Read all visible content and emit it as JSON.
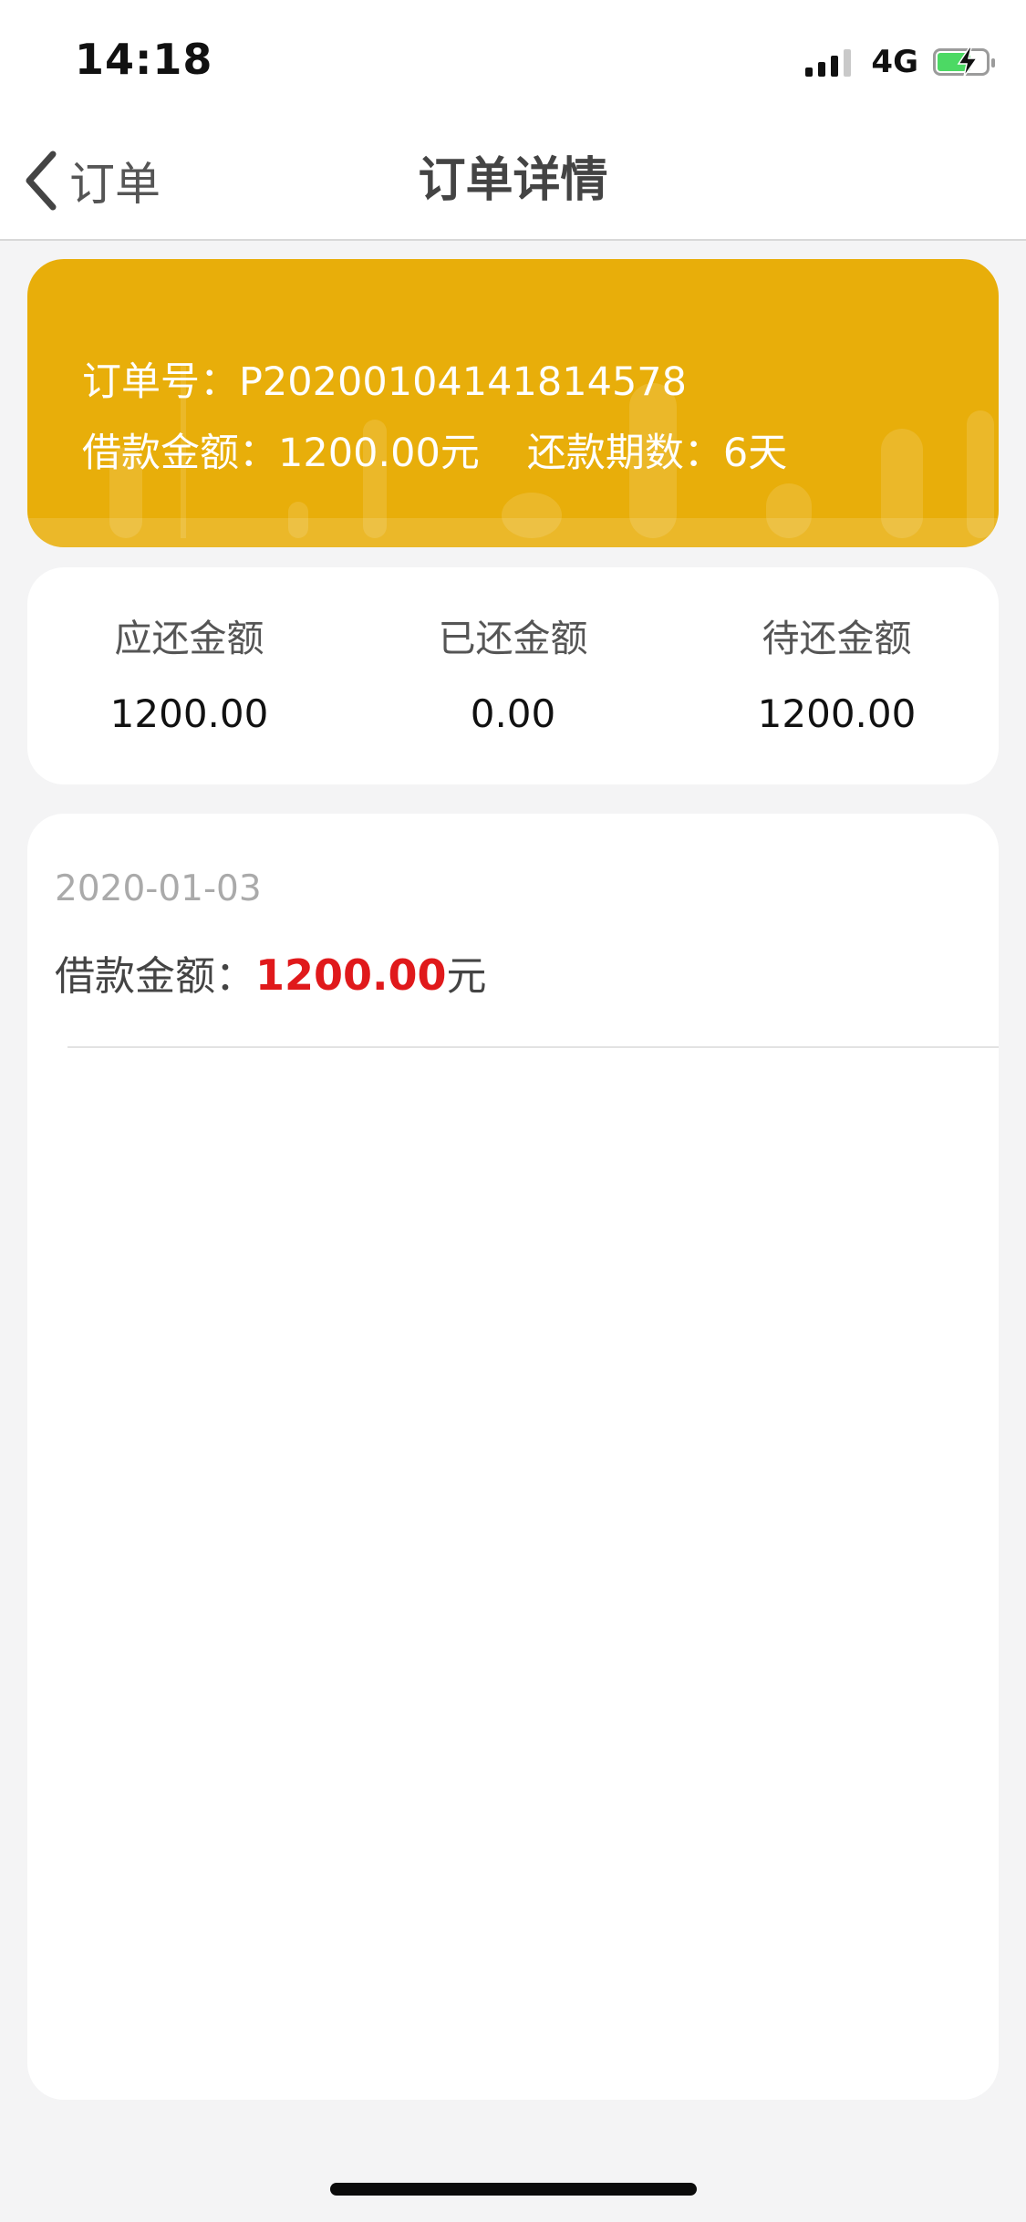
{
  "status_bar": {
    "time": "14:18",
    "network": "4G",
    "signal_level": 3,
    "battery_state": "charging"
  },
  "nav": {
    "back_label": "订单",
    "title": "订单详情",
    "back_icon": "chevron-left-icon"
  },
  "order": {
    "number_label": "订单号：",
    "number": "P20200104141814578",
    "loan_label": "借款金额：",
    "loan_amount": "1200.00",
    "loan_unit": "元",
    "period_label": "还款期数：",
    "period_value": "6",
    "period_unit": "天",
    "card_color": "#e8ae0a"
  },
  "summary": [
    {
      "label": "应还金额",
      "value": "1200.00"
    },
    {
      "label": "已还金额",
      "value": "0.00"
    },
    {
      "label": "待还金额",
      "value": "1200.00"
    }
  ],
  "records": [
    {
      "date": "2020-01-03",
      "amount_label": "借款金额：",
      "amount": "1200.00",
      "unit": "元"
    }
  ],
  "colors": {
    "accent": "#e8ae0a",
    "amount_red": "#e0191b",
    "background": "#f4f4f5"
  }
}
